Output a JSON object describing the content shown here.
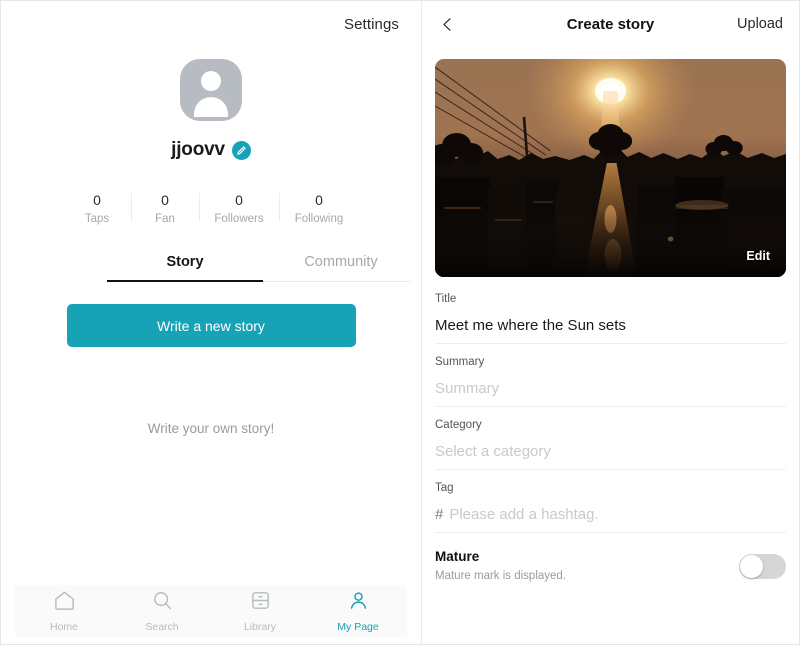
{
  "left": {
    "settings_label": "Settings",
    "profile": {
      "username": "jjoovv",
      "avatar_icon": "person-avatar-icon",
      "edit_icon": "pencil-icon"
    },
    "stats": [
      {
        "value": "0",
        "label": "Taps"
      },
      {
        "value": "0",
        "label": "Fan"
      },
      {
        "value": "0",
        "label": "Followers"
      },
      {
        "value": "0",
        "label": "Following"
      }
    ],
    "tabs": [
      {
        "label": "Story",
        "active": true
      },
      {
        "label": "Community",
        "active": false
      }
    ],
    "write_button_label": "Write a new story",
    "empty_state_text": "Write your own story!",
    "bottom_nav": [
      {
        "label": "Home",
        "icon": "home-icon",
        "active": false
      },
      {
        "label": "Search",
        "icon": "search-icon",
        "active": false
      },
      {
        "label": "Library",
        "icon": "library-icon",
        "active": false
      },
      {
        "label": "My Page",
        "icon": "person-icon",
        "active": true
      }
    ]
  },
  "right": {
    "back_icon": "chevron-left-icon",
    "title": "Create story",
    "upload_label": "Upload",
    "cover": {
      "edit_label": "Edit",
      "description": "Sunset photo of sun low over a dark alley with power lines and silhouetted trees"
    },
    "fields": [
      {
        "label": "Title",
        "value": "Meet me where the Sun sets",
        "placeholder": "",
        "is_placeholder": false
      },
      {
        "label": "Summary",
        "value": "Summary",
        "placeholder": "Summary",
        "is_placeholder": true
      },
      {
        "label": "Category",
        "value": "Select a category",
        "placeholder": "Select a category",
        "is_placeholder": true
      }
    ],
    "tag_field": {
      "label": "Tag",
      "hash": "#",
      "placeholder": "Please add a hashtag."
    },
    "mature": {
      "title": "Mature",
      "subtitle": "Mature mark is displayed.",
      "enabled": false
    }
  },
  "colors": {
    "accent_teal": "#18a2b5",
    "text_primary": "#111111",
    "text_muted": "#a8a8a8",
    "placeholder": "#c9c9c9",
    "divider": "#ececec"
  }
}
